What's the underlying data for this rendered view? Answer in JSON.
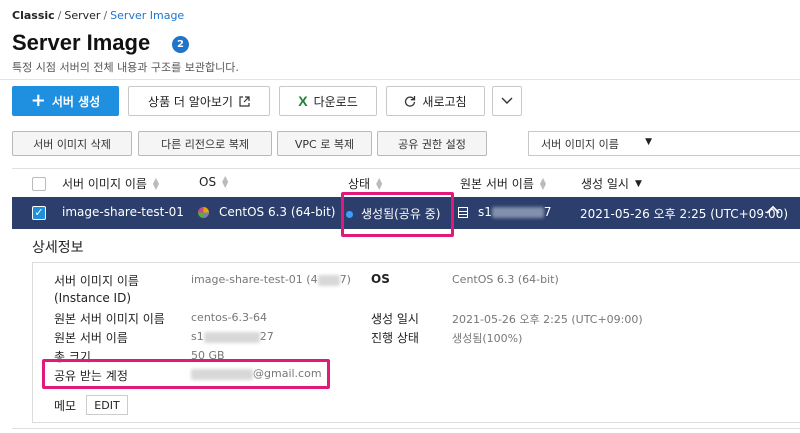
{
  "breadcrumb": [
    "Classic",
    "Server",
    "Server Image"
  ],
  "page": {
    "title": "Server Image",
    "count": "2",
    "description": "특정 시점 서버의 전체 내용과 구조를 보관합니다."
  },
  "toolbar": {
    "create": "서버 생성",
    "learn_more": "상품 더 알아보기",
    "download": "다운로드",
    "refresh": "새로고침"
  },
  "actions": {
    "delete": "서버 이미지 삭제",
    "copy_region": "다른 리전으로 복제",
    "copy_vpc": "VPC 로 복제",
    "share": "공유 권한 설정"
  },
  "search": {
    "selected_field": "서버 이미지 이름",
    "value": ""
  },
  "table": {
    "headers": [
      "서버 이미지 이름",
      "OS",
      "상태",
      "원본 서버 이름",
      "생성 일시"
    ],
    "row": {
      "name": "image-share-test-01",
      "os": "CentOS 6.3 (64-bit)",
      "status": "생성됨(공유 중)",
      "source_server": "s1",
      "source_server_end": "7",
      "created": "2021-05-26 오후 2:25 (UTC+09:00)"
    }
  },
  "detail": {
    "title": "상세정보",
    "labels": {
      "image_name": "서버 이미지 이름",
      "instance_id": "(Instance ID)",
      "os": "OS",
      "source_image": "원본 서버 이미지 이름",
      "created": "생성 일시",
      "source_server": "원본 서버 이름",
      "progress": "진행 상태",
      "total_size": "총 크기",
      "shared_account": "공유 받는 계정",
      "memo": "메모"
    },
    "values": {
      "image_name_prefix": "image-share-test-01 (4",
      "image_name_suffix": "7)",
      "os": "CentOS 6.3 (64-bit)",
      "source_image": "centos-6.3-64",
      "created": "2021-05-26 오후 2:25 (UTC+09:00)",
      "source_server_prefix": "s1",
      "source_server_suffix": "27",
      "progress": "생성됨(100%)",
      "total_size": "50 GB",
      "shared_account_suffix": "@gmail.com"
    },
    "edit": "EDIT"
  },
  "colors": {
    "primary": "#1f8fe0",
    "selected_row": "#2c3e6b",
    "highlight": "#e0197a",
    "link": "#1f75cb"
  }
}
